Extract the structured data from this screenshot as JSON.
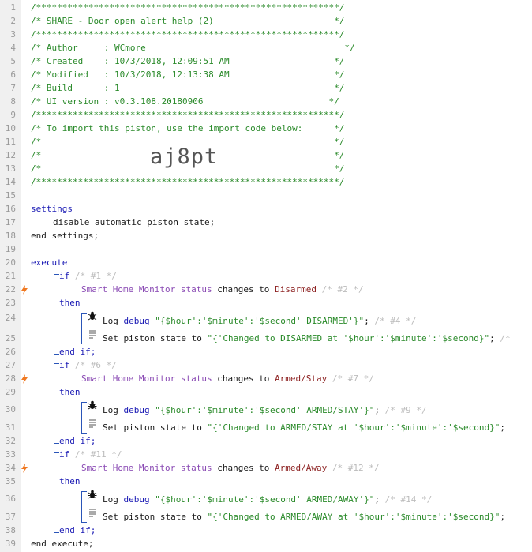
{
  "line_numbers": [
    "1",
    "2",
    "3",
    "4",
    "5",
    "6",
    "7",
    "8",
    "9",
    "10",
    "11",
    "12",
    "13",
    "14",
    "15",
    "16",
    "17",
    "18",
    "19",
    "20",
    "21",
    "22",
    "23",
    "24",
    "25",
    "26",
    "27",
    "28",
    "29",
    "30",
    "31",
    "32",
    "33",
    "34",
    "35",
    "36",
    "37",
    "38",
    "39"
  ],
  "header": {
    "border": "/**********************************************************/",
    "title": "/* SHARE - Door open alert help (2)                       */",
    "author": "/* Author     : WCmore                                      */",
    "created": "/* Created    : 10/3/2018, 12:09:51 AM                    */",
    "modified": "/* Modified   : 10/3/2018, 12:13:38 AM                    */",
    "build": "/* Build      : 1                                         */",
    "ui_version": "/* UI version : v0.3.108.20180906                        */",
    "import_hint": "/* To import this piston, use the import code below:      */",
    "blank": "/*                                                        */",
    "import_code": "aj8pt"
  },
  "settings": {
    "open": "settings",
    "line": "disable automatic piston state;",
    "close": "end settings;"
  },
  "execute": {
    "open": "execute",
    "close": "end execute;"
  },
  "kw": {
    "if": "if",
    "then": "then",
    "endif": "end if;"
  },
  "common": {
    "device": "Smart Home Monitor status",
    "changes_to": "changes to",
    "log": "Log",
    "debug": "debug",
    "set_state": "Set piston state to",
    "semicolon": ";"
  },
  "blocks": [
    {
      "if_comment": "/* #1 */",
      "value": "Disarmed",
      "cond_comment": "/* #2 */",
      "log_str": "\"{$hour':'$minute':'$second' DISARMED'}\"",
      "log_comment": "/* #4 */",
      "state_str": "\"{'Changed to DISARMED at '$hour':'$minute':'$second}\"",
      "state_comment": "/*"
    },
    {
      "if_comment": "/* #6 */",
      "value": "Armed/Stay",
      "cond_comment": "/* #7 */",
      "log_str": "\"{$hour':'$minute':'$second' ARMED/STAY'}\"",
      "log_comment": "/* #9 */",
      "state_str": "\"{'Changed to ARMED/STAY at '$hour':'$minute':'$second}\"",
      "state_comment": ""
    },
    {
      "if_comment": "/* #11 */",
      "value": "Armed/Away",
      "cond_comment": "/* #12 */",
      "log_str": "\"{$hour':'$minute':'$second' ARMED/AWAY'}\"",
      "log_comment": "/* #14 */",
      "state_str": "\"{'Changed to ARMED/AWAY at '$hour':'$minute':'$second}\"",
      "state_comment": ""
    }
  ],
  "icons": {
    "trigger": "lightning-icon",
    "log": "bug-icon",
    "state": "document-icon"
  },
  "colors": {
    "comment": "#2a8a2a",
    "keyword": "#1a1ab4",
    "device": "#8a4ab4",
    "value": "#8b1e1e",
    "bracket": "#2a55b8",
    "trigger": "#f07820"
  }
}
